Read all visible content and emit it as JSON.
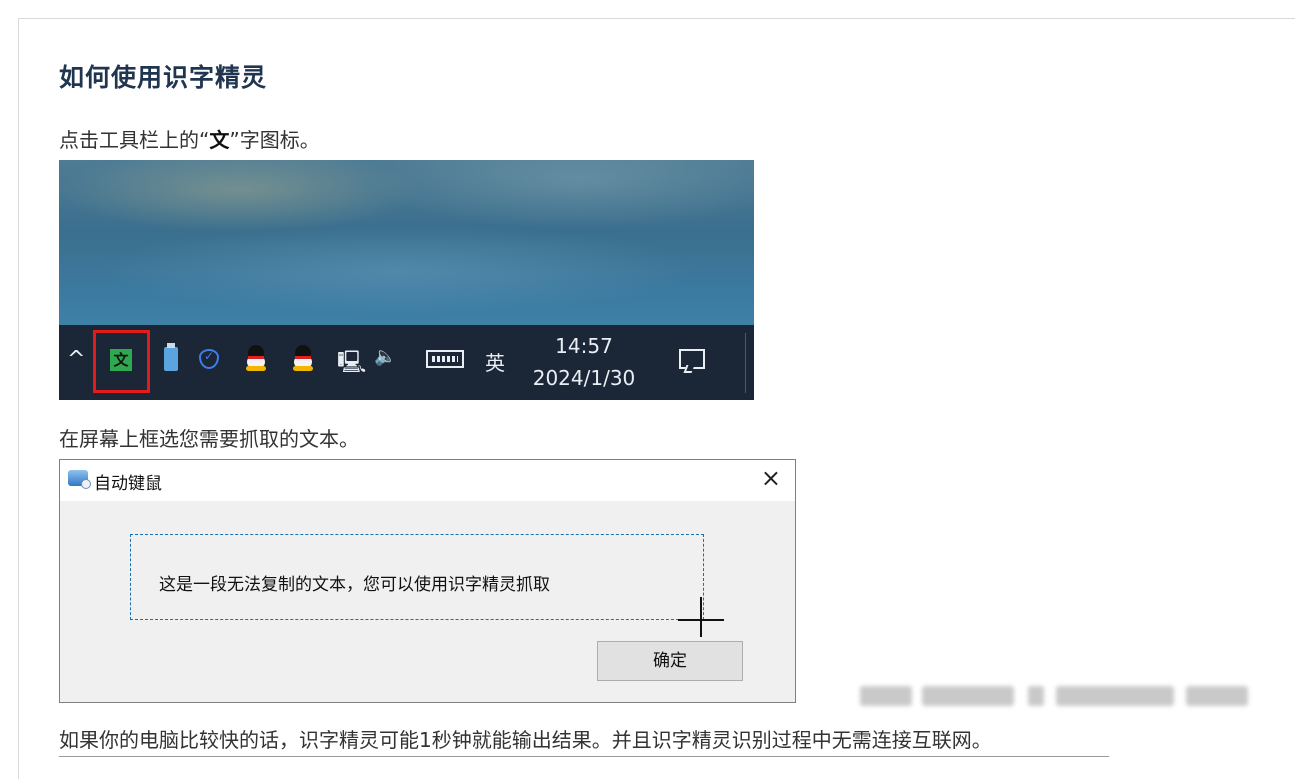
{
  "article": {
    "title": "如何使用识字精灵",
    "step1": {
      "before": "点击工具栏上的",
      "quote_open": "“",
      "highlight": "文",
      "quote_close": "”",
      "after": "字图标。"
    },
    "step2": "在屏幕上框选您需要抓取的文本。",
    "step3": "如果你的电脑比较快的话，识字精灵可能1秒钟就能输出结果。并且识字精灵识别过程中无需连接互联网。"
  },
  "taskbar": {
    "chevron": "^",
    "tray_icons": [
      "ocr-wen-icon",
      "usb-icon",
      "security-shield-icon",
      "qq-penguin-icon",
      "qq-penguin-icon",
      "network-icon",
      "volume-icon",
      "keyboard-icon"
    ],
    "wen_icon_label": "文",
    "wen_icon_color": "#2fa84f",
    "highlight_color": "#e31b1b",
    "ime": "英",
    "time": "14:57",
    "date": "2024/1/30"
  },
  "dialog": {
    "title": "自动键鼠",
    "close_symbol": "×",
    "message": "这是一段无法复制的文本，您可以使用识字精灵抓取",
    "ok_button": "确定"
  }
}
